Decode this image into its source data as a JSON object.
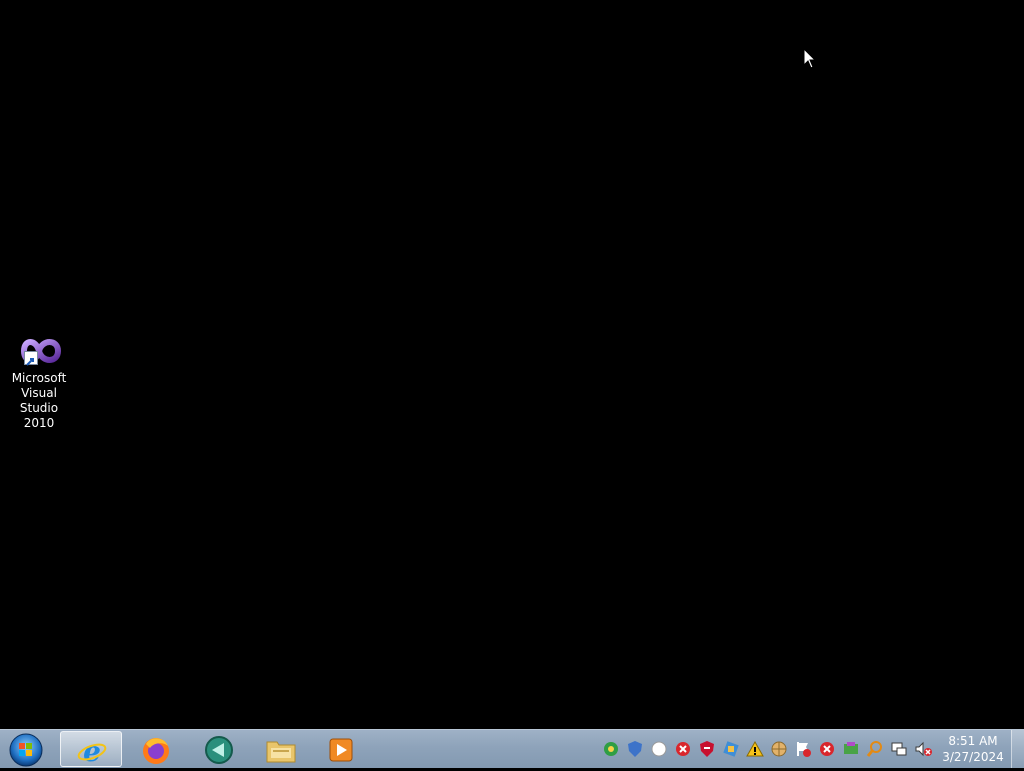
{
  "desktop": {
    "icons": [
      {
        "label": "Microsoft\nVisual Studio\n2010",
        "icon": "visual-studio-2010-icon"
      }
    ]
  },
  "taskbar": {
    "start_icon": "windows-start-orb-icon",
    "pinned": [
      {
        "name": "Internet Explorer",
        "icon": "internet-explorer-icon",
        "active": true
      },
      {
        "name": "Firefox",
        "icon": "firefox-icon",
        "active": false
      },
      {
        "name": "Media app",
        "icon": "media-app-icon",
        "active": false
      },
      {
        "name": "Windows Explorer",
        "icon": "folder-icon",
        "active": false
      },
      {
        "name": "Media Player",
        "icon": "media-player-icon",
        "active": false
      }
    ],
    "tray_icons": [
      "update-icon",
      "shield-icon",
      "circle-icon",
      "error-icon",
      "security-icon",
      "app-icon",
      "warning-icon",
      "globe-icon",
      "flag-icon",
      "error-icon-2",
      "app-icon-2",
      "search-icon",
      "network-icon",
      "volume-muted-icon"
    ],
    "clock": {
      "time": "8:51 AM",
      "date": "3/27/2024"
    }
  },
  "colors": {
    "desktop_bg": "#000000",
    "taskbar_top": "#9fb1c6",
    "taskbar_bottom": "#8399b1"
  }
}
